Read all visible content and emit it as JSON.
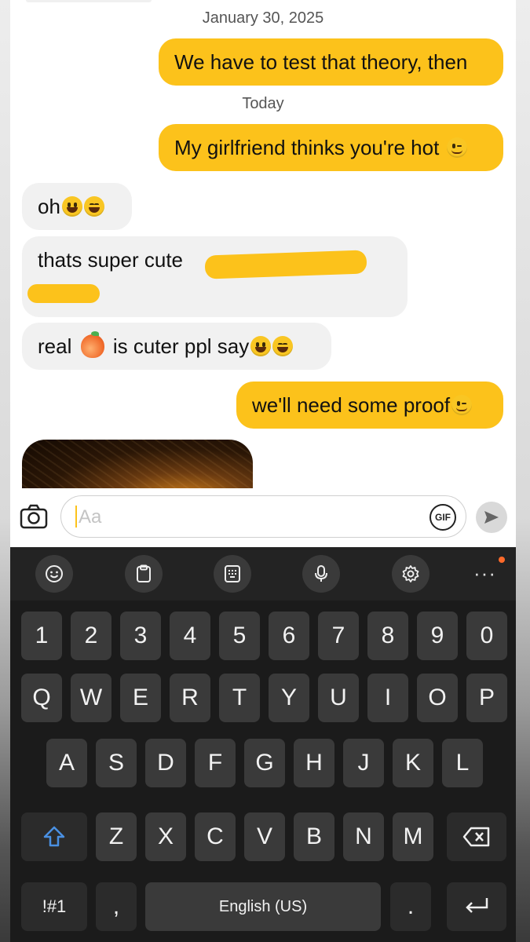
{
  "chat": {
    "date_1": "January 30, 2025",
    "msg_1": "We have to test that theory, then",
    "date_2": "Today",
    "msg_2": "My girlfriend thinks you're hot",
    "msg_3": "oh",
    "msg_4": "thats super cute",
    "msg_5a": "real",
    "msg_5b": "is cuter ppl say",
    "msg_6": "we'll need some proof",
    "emoji_icons": [
      "wink-emoji-icon",
      "grin-emoji-icon",
      "laugh-emoji-icon",
      "peach-emoji-icon"
    ],
    "accent_color": "#fcc21b"
  },
  "input": {
    "placeholder": "Aa",
    "gif_label": "GIF"
  },
  "keyboard": {
    "toolbar_icons": [
      "emoji-icon",
      "clipboard-icon",
      "keypad-icon",
      "mic-icon",
      "gear-icon",
      "more-icon"
    ],
    "more_label": "···",
    "row_numbers": [
      "1",
      "2",
      "3",
      "4",
      "5",
      "6",
      "7",
      "8",
      "9",
      "0"
    ],
    "row_1": [
      "Q",
      "W",
      "E",
      "R",
      "T",
      "Y",
      "U",
      "I",
      "O",
      "P"
    ],
    "row_2": [
      "A",
      "S",
      "D",
      "F",
      "G",
      "H",
      "J",
      "K",
      "L"
    ],
    "row_3": [
      "Z",
      "X",
      "C",
      "V",
      "B",
      "N",
      "M"
    ],
    "symbols_label": "!#1",
    "comma_label": ",",
    "space_label": "English (US)",
    "period_label": "."
  }
}
